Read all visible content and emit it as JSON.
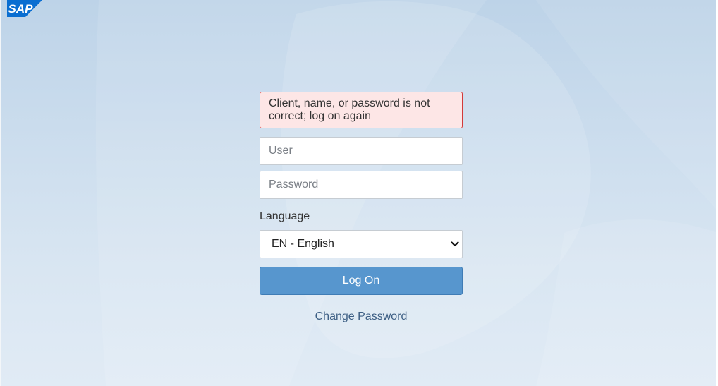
{
  "logo": {
    "text": "SAP",
    "color": "#0a6ed1",
    "icon": "sap-logo-icon"
  },
  "error": {
    "message": "Client, name, or password is not correct; log on again",
    "background_color": "#fde6e6",
    "border_color": "#d23a3a"
  },
  "form": {
    "user": {
      "placeholder": "User",
      "value": ""
    },
    "password": {
      "placeholder": "Password",
      "value": ""
    },
    "language": {
      "label": "Language",
      "selected": "EN - English",
      "icon": "chevron-down-icon"
    },
    "logon_button": {
      "label": "Log On",
      "color": "#5796ce"
    },
    "change_password": {
      "label": "Change Password"
    }
  }
}
